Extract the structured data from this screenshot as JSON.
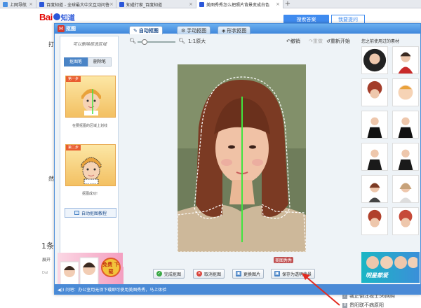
{
  "browser": {
    "tabs": [
      {
        "label": "上网导航",
        "fav": "#4a90e2"
      },
      {
        "label": "百度知道 - 全球最大中文互动问答",
        "fav": "#2b57d9"
      },
      {
        "label": "知道行家_百度知道",
        "fav": "#2b57d9"
      },
      {
        "label": "美图秀秀怎么把照片背景变成白色",
        "fav": "#2b57d9"
      }
    ],
    "new_tab": "+"
  },
  "zhidao": {
    "logo_text": "Bai",
    "logo_text2": "知道",
    "search_btn": "搜索答案",
    "ask_btn": "我要提问",
    "frag_hit": "打",
    "frag_ran": "然",
    "answers": "1条",
    "sort": "展开",
    "dul": "Dul",
    "right_items": [
      {
        "num": "7",
        "text": "我正倒注视士56网购"
      },
      {
        "num": "8",
        "text": "贵阳联不病原阳"
      }
    ]
  },
  "dialog": {
    "title": "抠图",
    "tabs": [
      {
        "label": "自动抠图",
        "icon": "brush-icon"
      },
      {
        "label": "手动抠图",
        "icon": "gear-icon"
      },
      {
        "label": "形状抠图",
        "icon": "shape-icon"
      }
    ],
    "left": {
      "hint": "可以删除抠选区域",
      "cut_btn": "抠图笔",
      "erase_btn": "删除笔",
      "step1_label": "第一步",
      "step1_caption": "在要抠图的区域上划线",
      "step2_label": "第二步",
      "step2_caption": "抠图成功!",
      "tutorial": "自动抠图教程",
      "ad_badge": "免费\n下载"
    },
    "toolbar": {
      "zoom_out": "−",
      "zoom_in": "+",
      "original": "1:1原大",
      "undo": "撤销",
      "redo": "重做",
      "restart": "重新开始"
    },
    "watermark": "美图秀秀",
    "bottom": [
      {
        "label": "完成抠图",
        "color": "#3aa845",
        "glyph": "✓"
      },
      {
        "label": "取消抠图",
        "color": "#d9433b",
        "glyph": "✕"
      },
      {
        "label": "更换图片",
        "color": "#4a84c6",
        "glyph": "▣"
      },
      {
        "label": "保存为透明背景",
        "color": "#4a84c6",
        "glyph": "▣"
      }
    ],
    "right": {
      "title": "您之前使用过的素材",
      "ad_text": "明星都爱"
    },
    "status": "问吧：办公室用无须下载即可使用美图秀秀，马上体验"
  }
}
